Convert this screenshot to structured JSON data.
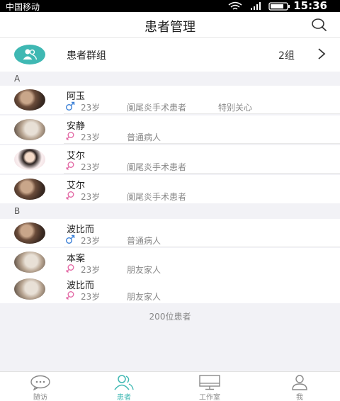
{
  "statusbar": {
    "carrier": "中国移动",
    "time": "15:36"
  },
  "navbar": {
    "title": "患者管理",
    "search_icon": "search-icon"
  },
  "group": {
    "label": "患者群组",
    "count": "2组",
    "arrow": ">"
  },
  "sections": [
    {
      "letter": "A",
      "patients": [
        {
          "name": "阿玉",
          "sex": "male",
          "age": "23岁",
          "category": "阑尾炎手术患者",
          "tag": "特别关心"
        },
        {
          "name": "安静",
          "sex": "female",
          "age": "23岁",
          "category": "普通病人",
          "tag": ""
        },
        {
          "name": "艾尔",
          "sex": "female",
          "age": "23岁",
          "category": "阑尾炎手术患者",
          "tag": ""
        },
        {
          "name": "艾尔",
          "sex": "female",
          "age": "23岁",
          "category": "阑尾炎手术患者",
          "tag": ""
        }
      ]
    },
    {
      "letter": "B",
      "patients": [
        {
          "name": "波比而",
          "sex": "male",
          "age": "23岁",
          "category": "普通病人",
          "tag": ""
        },
        {
          "name": "本案",
          "sex": "female",
          "age": "23岁",
          "category": "朋友家人",
          "tag": ""
        },
        {
          "name": "波比而",
          "sex": "female",
          "age": "23岁",
          "category": "朋友家人",
          "tag": ""
        }
      ]
    }
  ],
  "total": "200位患者",
  "colors": {
    "accent": "#3fb8b3",
    "male": "#3a7fd6",
    "female": "#e36aa6"
  },
  "tabs": [
    {
      "label": "随访",
      "icon": "chat-bubble-icon",
      "active": false
    },
    {
      "label": "患者",
      "icon": "patients-icon",
      "active": true
    },
    {
      "label": "工作室",
      "icon": "monitor-icon",
      "active": false
    },
    {
      "label": "我",
      "icon": "user-icon",
      "active": false
    }
  ]
}
